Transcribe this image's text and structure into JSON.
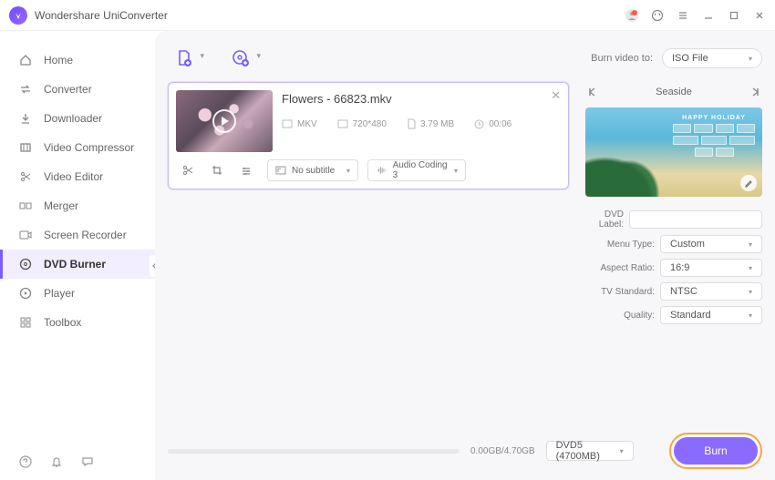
{
  "app": {
    "title": "Wondershare UniConverter"
  },
  "sidebar": {
    "items": [
      {
        "label": "Home"
      },
      {
        "label": "Converter"
      },
      {
        "label": "Downloader"
      },
      {
        "label": "Video Compressor"
      },
      {
        "label": "Video Editor"
      },
      {
        "label": "Merger"
      },
      {
        "label": "Screen Recorder"
      },
      {
        "label": "DVD Burner"
      },
      {
        "label": "Player"
      },
      {
        "label": "Toolbox"
      }
    ]
  },
  "toolbar": {
    "burn_to_label": "Burn video to:",
    "burn_to_value": "ISO File"
  },
  "file": {
    "name": "Flowers - 66823.mkv",
    "format": "MKV",
    "resolution": "720*480",
    "size": "3.79 MB",
    "duration": "00:06",
    "subtitle": "No subtitle",
    "audio": "Audio Coding 3"
  },
  "template": {
    "name": "Seaside",
    "banner_title": "HAPPY HOLIDAY"
  },
  "settings": {
    "dvd_label_label": "DVD Label:",
    "dvd_label_value": "",
    "menu_type_label": "Menu Type:",
    "menu_type_value": "Custom",
    "aspect_ratio_label": "Aspect Ratio:",
    "aspect_ratio_value": "16:9",
    "tv_standard_label": "TV Standard:",
    "tv_standard_value": "NTSC",
    "quality_label": "Quality:",
    "quality_value": "Standard"
  },
  "footer": {
    "size_text": "0.00GB/4.70GB",
    "disc_value": "DVD5 (4700MB)",
    "burn_label": "Burn"
  }
}
